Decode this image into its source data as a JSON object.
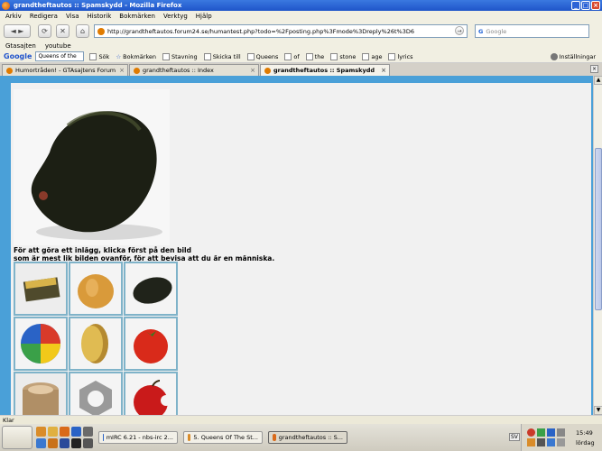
{
  "window": {
    "title": "grandtheftautos :: Spamskydd - Mozilla Firefox"
  },
  "menu": [
    "Arkiv",
    "Redigera",
    "Visa",
    "Historik",
    "Bokmärken",
    "Verktyg",
    "Hjälp"
  ],
  "nav": {
    "url": "http://grandtheftautos.forum24.se/humantest.php?todo=%2Fposting.php%3Fmode%3Dreply%26t%3D6",
    "search_placeholder": "Google"
  },
  "bookmarks": [
    "Gtasajten",
    "youtube"
  ],
  "google_toolbar": {
    "logo": "Google",
    "query": "Queens of the",
    "items": [
      "Sök",
      "Bokmärken",
      "Stavning",
      "Skicka till",
      "Queens",
      "of",
      "the",
      "stone",
      "age",
      "lyrics",
      "Inställningar"
    ]
  },
  "tabs": [
    {
      "label": "Humortråden! - GTAsajtens Forum"
    },
    {
      "label": "grandtheftautos :: Index"
    },
    {
      "label": "grandtheftautos :: Spamskydd"
    }
  ],
  "content": {
    "prompt_line1": "För att göra ett inlägg, klicka först på den bild",
    "prompt_line2": "som är mest lik bilden ovanför, för att bevisa att du är en människa."
  },
  "statusbar": {
    "text": "Klar"
  },
  "taskbar": {
    "tasks": [
      "mIRC 6.21 - nbs-irc 2...",
      "5. Queens Of The St...",
      "grandtheftautos :: S..."
    ],
    "language": "SV",
    "time": "15:49",
    "day": "lördag"
  }
}
